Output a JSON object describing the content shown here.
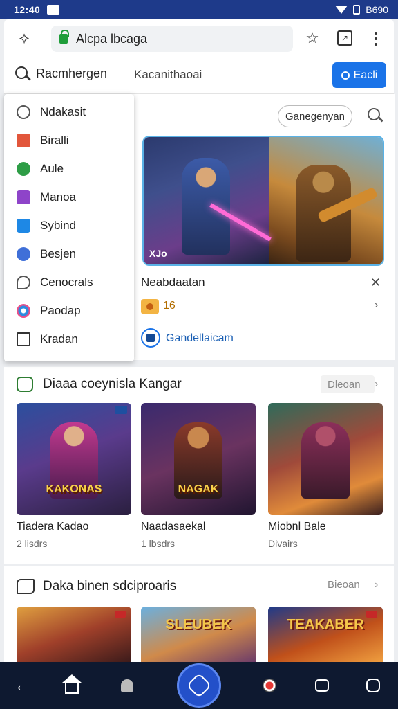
{
  "status": {
    "time": "12:40",
    "battery": "B690"
  },
  "browser": {
    "url": "Alcpa lbcaga",
    "search_query": "Racmhergen",
    "secondary_label": "Kacanithaoai",
    "primary_button": "Eacli"
  },
  "dropdown": {
    "items": [
      {
        "label": "Ndakasit",
        "icon": "user-outline-icon",
        "color": "#555555"
      },
      {
        "label": "Biralli",
        "icon": "orange-app-icon",
        "color": "#e2563b"
      },
      {
        "label": "Aule",
        "icon": "green-leaf-icon",
        "color": "#2e9d46"
      },
      {
        "label": "Manoa",
        "icon": "purple-app-icon",
        "color": "#8e44c9"
      },
      {
        "label": "Sybind",
        "icon": "blue-app-icon",
        "color": "#1e88e5"
      },
      {
        "label": "Besjen",
        "icon": "blue-circle-icon",
        "color": "#3f6fd8"
      },
      {
        "label": "Cenocrals",
        "icon": "chat-bubble-icon",
        "color": "#555555"
      },
      {
        "label": "Paodap",
        "icon": "flower-icon",
        "color": "#2c8be0"
      },
      {
        "label": "Kradan",
        "icon": "bookmark-icon",
        "color": "#333333"
      }
    ]
  },
  "featured": {
    "chip": "Ganegenyan",
    "hero_tag": "XJo",
    "title": "Neabdaatan",
    "rating": "16",
    "app_label": "Gandellaicam"
  },
  "section1": {
    "title": "Diaaa coeynisla Kangar",
    "more": "Dleoan",
    "tiles": [
      {
        "title": "Tiadera Kadao",
        "sub": "2 lisdrs",
        "logo": "KAKONAS"
      },
      {
        "title": "Naadasaekal",
        "sub": "1 lbsdrs",
        "logo": "NAGAK"
      },
      {
        "title": "Miobnl Bale",
        "sub": "Divairs",
        "logo": ""
      }
    ]
  },
  "section2": {
    "title": "Daka binen sdciproaris",
    "more": "Bieoan",
    "tiles": [
      {
        "logo": ""
      },
      {
        "logo": "SLEUBEK"
      },
      {
        "logo": "TEAKABER"
      }
    ]
  },
  "colors": {
    "status_bar": "#1e3a8a",
    "accent": "#1a73e8",
    "nav_bar": "#0e1930"
  }
}
